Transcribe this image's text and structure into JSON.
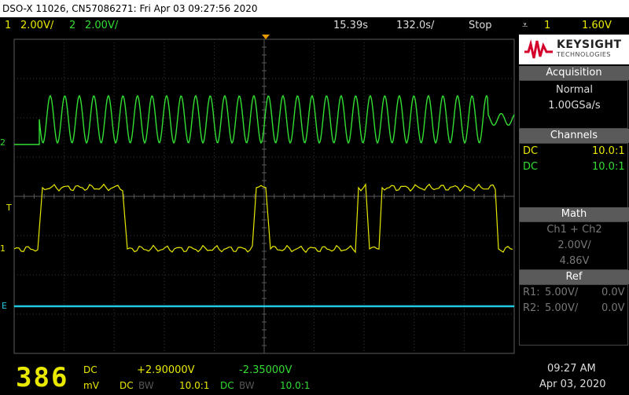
{
  "title": "DSO-X 11026, CN57086271: Fri Apr 03 09:27:56 2020",
  "status": {
    "ch1_num": "1",
    "ch1_scale": "2.00V/",
    "ch2_num": "2",
    "ch2_scale": "2.00V/",
    "timebase": "15.39s",
    "delay": "132.0s/",
    "run_state": "Stop",
    "trigger_channel": "1",
    "trigger_level": "1.60V"
  },
  "logo": {
    "brand": "KEYSIGHT",
    "sub": "TECHNOLOGIES"
  },
  "acquisition": {
    "header": "Acquisition",
    "mode": "Normal",
    "rate": "1.00GSa/s"
  },
  "channels": {
    "header": "Channels",
    "rows": [
      {
        "coupling": "DC",
        "probe": "10.0:1"
      },
      {
        "coupling": "DC",
        "probe": "10.0:1"
      }
    ]
  },
  "math": {
    "header": "Math",
    "function": "Ch1 + Ch2",
    "scale": "2.00V/",
    "offset": "4.86V"
  },
  "ref": {
    "header": "Ref",
    "rows": [
      {
        "label": "R1:",
        "scale": "5.00V/",
        "offset": "0.0V"
      },
      {
        "label": "R2:",
        "scale": "5.00V/",
        "offset": "0.0V"
      }
    ]
  },
  "markers": {
    "ch1": "1",
    "ch2": "2",
    "trigger": "T",
    "math": "E"
  },
  "bottom": {
    "big_value": "386",
    "big_unit": "mV",
    "big_coupling": "DC",
    "ch1_offset": "+2.90000V",
    "ch2_offset": "-2.35000V",
    "ch1_coupling": "DC",
    "ch1_bw": "BW",
    "ch1_probe": "10.0:1",
    "ch2_coupling": "DC",
    "ch2_bw": "BW",
    "ch2_probe": "10.0:1",
    "time": "09:27 AM",
    "date": "Apr 03, 2020"
  },
  "colors": {
    "ch1": "#e8e800",
    "ch2": "#33dd33",
    "math": "#22c8e0",
    "panel_header": "#5a5a5a"
  }
}
